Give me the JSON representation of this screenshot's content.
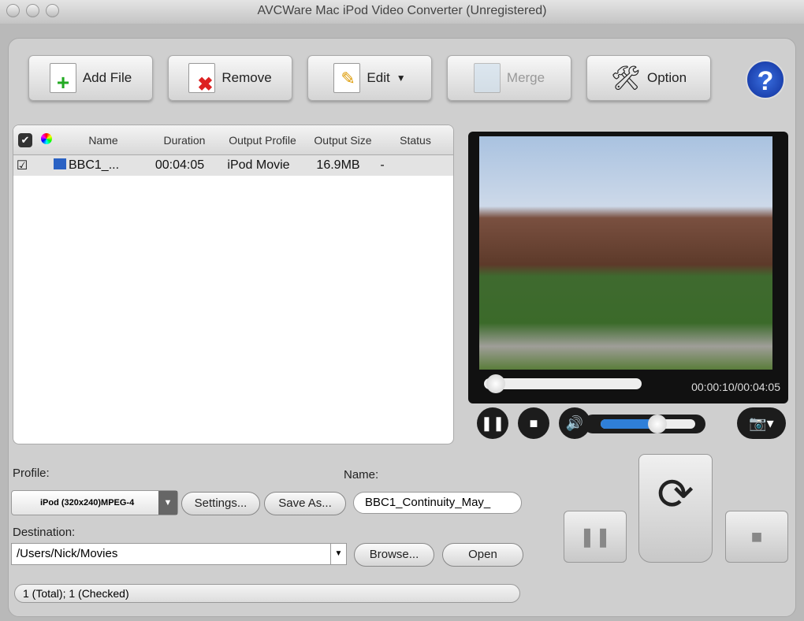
{
  "window": {
    "title": "AVCWare Mac iPod Video Converter (Unregistered)"
  },
  "toolbar": {
    "add_file": "Add File",
    "remove": "Remove",
    "edit": "Edit",
    "merge": "Merge",
    "option": "Option",
    "help": "?"
  },
  "file_list": {
    "columns": [
      "Name",
      "Duration",
      "Output Profile",
      "Output Size",
      "Status"
    ],
    "rows": [
      {
        "checked": true,
        "name": "BBC1_...",
        "duration": "00:04:05",
        "profile": "iPod Movie",
        "size": "16.9MB",
        "status": "-"
      }
    ]
  },
  "player": {
    "time": "00:00:10/00:04:05",
    "progress_percent": 4,
    "volume_percent": 60
  },
  "settings": {
    "profile_label": "Profile:",
    "profile_value": "iPod (320x240)MPEG-4",
    "settings_button": "Settings...",
    "save_as_button": "Save As...",
    "name_label": "Name:",
    "name_value": "BBC1_Continuity_May_",
    "destination_label": "Destination:",
    "destination_value": "/Users/Nick/Movies",
    "browse_button": "Browse...",
    "open_button": "Open"
  },
  "status": {
    "text": "1 (Total); 1 (Checked)"
  },
  "colors": {
    "accent": "#2f7fd8",
    "help": "#1f4fc8"
  }
}
